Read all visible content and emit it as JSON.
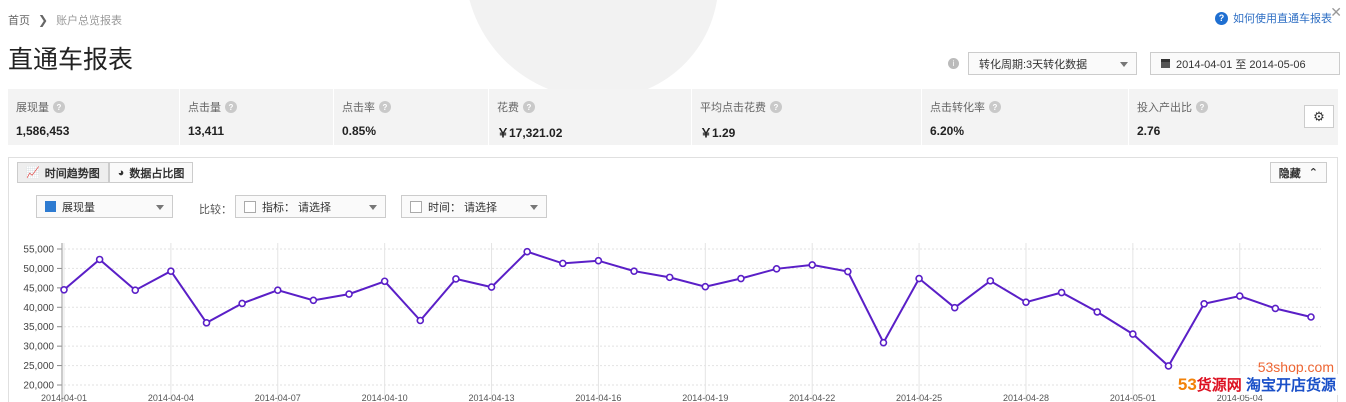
{
  "breadcrumb": {
    "home": "首页",
    "separator": "❯",
    "current": "账户总览报表"
  },
  "page": {
    "title": "直通车报表"
  },
  "help": {
    "label": "如何使用直通车报表",
    "icon": "?"
  },
  "filters": {
    "period": "转化周期:3天转化数据",
    "date_range": "2014-04-01 至 2014-05-06"
  },
  "metrics": [
    {
      "label": "展现量",
      "value": "1,586,453"
    },
    {
      "label": "点击量",
      "value": "13,411"
    },
    {
      "label": "点击率",
      "value": "0.85%"
    },
    {
      "label": "花费",
      "value": "￥17,321.02"
    },
    {
      "label": "平均点击花费",
      "value": "￥1.29"
    },
    {
      "label": "点击转化率",
      "value": "6.20%"
    },
    {
      "label": "投入产出比",
      "value": "2.76"
    }
  ],
  "panel": {
    "tabs": [
      {
        "label": "时间趋势图"
      },
      {
        "label": "数据占比图"
      }
    ],
    "hide_label": "隐藏",
    "metric_select": "展现量",
    "compare_label": "比较：",
    "compare_metric": "指标：  请选择",
    "compare_time": "时间：  请选择"
  },
  "colors": {
    "line": "#5a1fc7",
    "accent": "#2e7bd1",
    "brand_orange": "#f2820a"
  },
  "chart_data": {
    "type": "line",
    "series": [
      {
        "name": "展现量",
        "values": [
          44500,
          52300,
          44400,
          49300,
          36000,
          41000,
          44400,
          41800,
          43400,
          46700,
          36600,
          47300,
          45200,
          54300,
          51300,
          52000,
          49300,
          47700,
          45300,
          47400,
          49900,
          50900,
          49200,
          30900,
          47400,
          39900,
          46800,
          41300,
          43800,
          38800,
          33100,
          24900,
          40900,
          42900,
          39700,
          37500
        ]
      }
    ],
    "x_tick_labels": [
      "2014-04-01",
      "2014-04-04",
      "2014-04-07",
      "2014-04-10",
      "2014-04-13",
      "2014-04-16",
      "2014-04-19",
      "2014-04-22",
      "2014-04-25",
      "2014-04-28",
      "2014-05-01",
      "2014-05-04"
    ],
    "y_ticks": [
      20000,
      25000,
      30000,
      35000,
      40000,
      45000,
      50000,
      55000
    ],
    "y_tick_labels": [
      "20,000",
      "25,000",
      "30,000",
      "35,000",
      "40,000",
      "45,000",
      "50,000",
      "55,000"
    ],
    "ylim": [
      20000,
      55000
    ],
    "grid": true
  },
  "watermark": {
    "domain": "53shop.com",
    "brand_num": "53",
    "brand_name": "货源网",
    "tagline": "淘宝开店货源"
  }
}
